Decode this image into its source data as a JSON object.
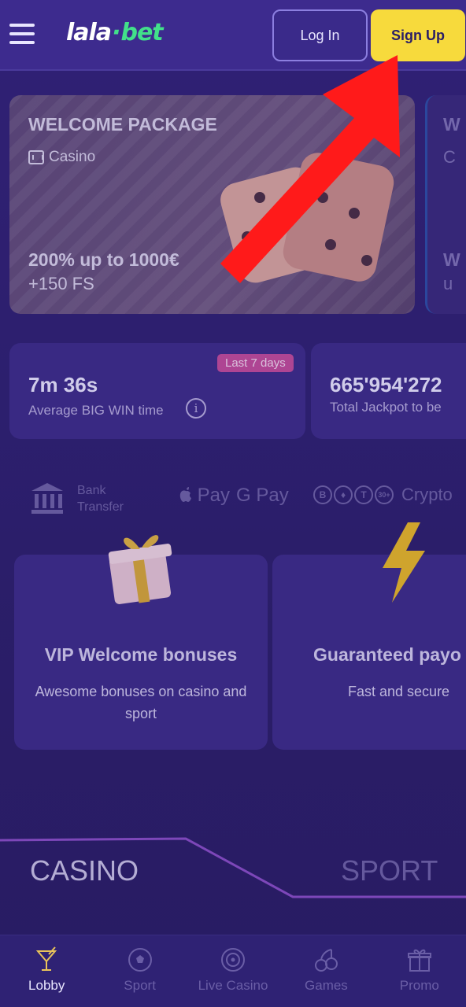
{
  "header": {
    "logo_part1": "lala",
    "logo_dot": "·",
    "logo_part2": "bet",
    "login_label": "Log In",
    "signup_label": "Sign Up"
  },
  "promo_banner": {
    "title": "WELCOME PACKAGE",
    "category": "Casino",
    "offer": "200% up to 1000€",
    "free_spins": "+150 FS",
    "next_title_partial": "W",
    "next_sub_partial": "C",
    "next_offer_partial": "W",
    "next_fs_partial": "u"
  },
  "stats": {
    "win_time": {
      "badge": "Last 7 days",
      "value": "7m 36s",
      "label": "Average BIG WIN time"
    },
    "jackpot": {
      "value": "665'954'272",
      "label": "Total Jackpot to be"
    }
  },
  "payments": {
    "bank_line1": "Bank",
    "bank_line2": "Transfer",
    "apple_pay": " Pay",
    "google_pay": "G Pay",
    "coin_btc": "B",
    "coin_eth": "♦",
    "coin_usdt": "T",
    "coin_more": "30+",
    "crypto": "Crypto"
  },
  "features": [
    {
      "title": "VIP Welcome bonuses",
      "desc": "Awesome bonuses on casino and sport"
    },
    {
      "title": "Guaranteed payo",
      "desc": "Fast and secure"
    }
  ],
  "switcher": {
    "casino": "CASINO",
    "sport": "SPORT"
  },
  "bottom_nav": [
    {
      "label": "Lobby",
      "icon": "cocktail-icon",
      "active": true
    },
    {
      "label": "Sport",
      "icon": "soccer-ball-icon",
      "active": false
    },
    {
      "label": "Live Casino",
      "icon": "roulette-icon",
      "active": false
    },
    {
      "label": "Games",
      "icon": "cherries-icon",
      "active": false
    },
    {
      "label": "Promo",
      "icon": "gift-icon",
      "active": false
    }
  ],
  "colors": {
    "background": "#2f2270",
    "header": "#3d2b8e",
    "signup": "#f7da3c",
    "accent_green": "#42e08a",
    "badge": "#c24d9c",
    "arrow": "#ff1a1a"
  }
}
